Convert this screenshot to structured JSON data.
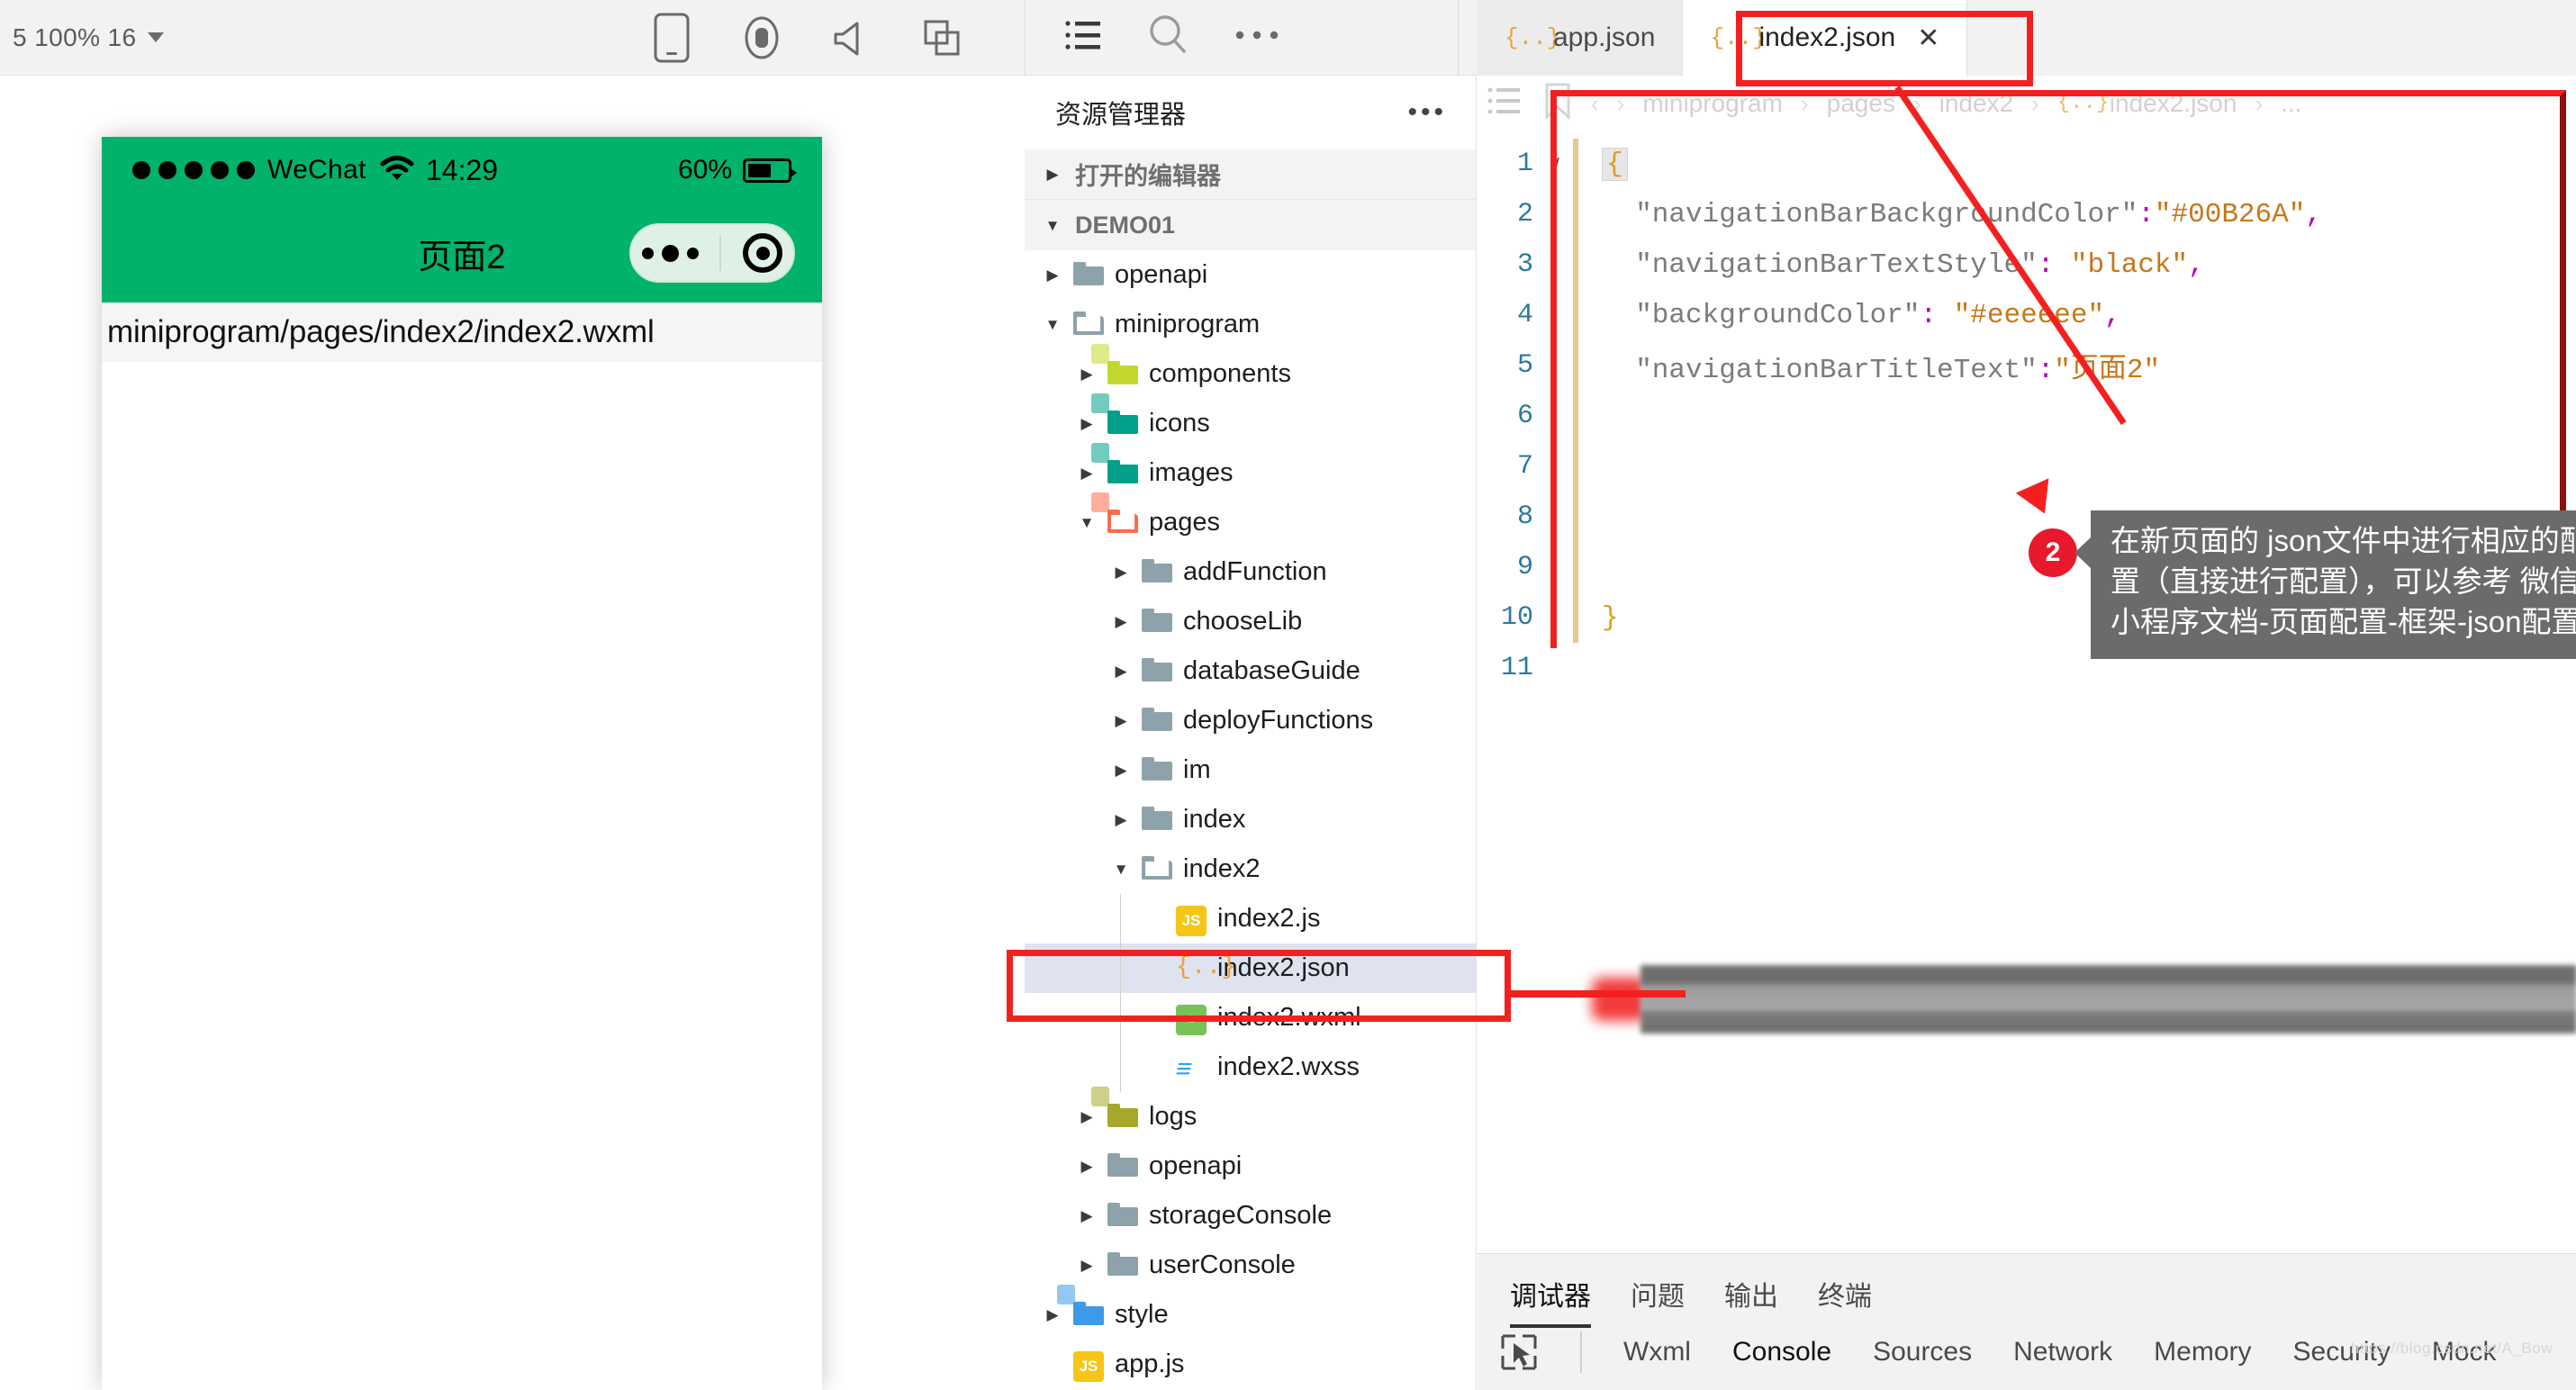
{
  "toolbar": {
    "zoom_label": "5 100% 16",
    "icons": [
      {
        "name": "device-phone-icon"
      },
      {
        "name": "record-icon"
      },
      {
        "name": "volume-icon"
      },
      {
        "name": "copy-window-icon"
      }
    ],
    "mid_icons": [
      {
        "name": "list-menu-icon"
      },
      {
        "name": "search-icon"
      },
      {
        "name": "more-ellipsis-icon"
      }
    ],
    "right_icon": {
      "name": "collapse-panel-icon"
    }
  },
  "simulator": {
    "statusbar": {
      "carrier": "WeChat",
      "time": "14:29",
      "battery_percent": "60%"
    },
    "navbar": {
      "title": "页面2",
      "background_color": "#00B26A"
    },
    "path_label": "miniprogram/pages/index2/index2.wxml"
  },
  "explorer": {
    "title": "资源管理器",
    "more_label": "•••",
    "sections": [
      {
        "label": "打开的编辑器",
        "expanded": false
      },
      {
        "label": "DEMO01",
        "expanded": true
      }
    ],
    "tree": [
      {
        "label": "openapi",
        "depth": 1,
        "type": "folder",
        "state": "right",
        "color": "#8da2ab"
      },
      {
        "label": "miniprogram",
        "depth": 1,
        "type": "folder-open",
        "state": "down",
        "color": "#8da2ab"
      },
      {
        "label": "components",
        "depth": 2,
        "type": "folder",
        "state": "right",
        "color": "#c4d72e",
        "badge": "<>"
      },
      {
        "label": "icons",
        "depth": 2,
        "type": "folder",
        "state": "right",
        "color": "#00a08a",
        "badge": "img"
      },
      {
        "label": "images",
        "depth": 2,
        "type": "folder",
        "state": "right",
        "color": "#00a08a",
        "badge": "img"
      },
      {
        "label": "pages",
        "depth": 2,
        "type": "folder-open",
        "state": "down",
        "color": "#ff6b4a",
        "badge": "<>"
      },
      {
        "label": "addFunction",
        "depth": 3,
        "type": "folder",
        "state": "right",
        "color": "#8da2ab"
      },
      {
        "label": "chooseLib",
        "depth": 3,
        "type": "folder",
        "state": "right",
        "color": "#8da2ab"
      },
      {
        "label": "databaseGuide",
        "depth": 3,
        "type": "folder",
        "state": "right",
        "color": "#8da2ab"
      },
      {
        "label": "deployFunctions",
        "depth": 3,
        "type": "folder",
        "state": "right",
        "color": "#8da2ab"
      },
      {
        "label": "im",
        "depth": 3,
        "type": "folder",
        "state": "right",
        "color": "#8da2ab"
      },
      {
        "label": "index",
        "depth": 3,
        "type": "folder",
        "state": "right",
        "color": "#8da2ab"
      },
      {
        "label": "index2",
        "depth": 3,
        "type": "folder-open",
        "state": "down",
        "color": "#8da2ab"
      },
      {
        "label": "index2.js",
        "depth": 4,
        "type": "js"
      },
      {
        "label": "index2.json",
        "depth": 4,
        "type": "json",
        "selected": true
      },
      {
        "label": "index2.wxml",
        "depth": 4,
        "type": "wxml"
      },
      {
        "label": "index2.wxss",
        "depth": 4,
        "type": "wxss"
      },
      {
        "label": "logs",
        "depth": 2,
        "type": "folder",
        "state": "right",
        "color": "#a5a82a",
        "badge": "log"
      },
      {
        "label": "openapi",
        "depth": 2,
        "type": "folder",
        "state": "right",
        "color": "#8da2ab"
      },
      {
        "label": "storageConsole",
        "depth": 2,
        "type": "folder",
        "state": "right",
        "color": "#8da2ab"
      },
      {
        "label": "userConsole",
        "depth": 2,
        "type": "folder",
        "state": "right",
        "color": "#8da2ab"
      },
      {
        "label": "style",
        "depth": 1,
        "type": "folder",
        "state": "right",
        "color": "#3d9ae8",
        "badge": "css"
      },
      {
        "label": "app.js",
        "depth": 1,
        "type": "js"
      }
    ]
  },
  "editor": {
    "tabs": [
      {
        "label": "app.json",
        "icon": "json-icon",
        "active": false,
        "closable": false
      },
      {
        "label": "index2.json",
        "icon": "json-icon",
        "active": true,
        "closable": true,
        "close_label": "✕"
      }
    ],
    "breadcrumb": [
      "miniprogram",
      "pages",
      "index2",
      "index2.json",
      "..."
    ],
    "breadcrumb_sep": "›",
    "breadcrumb_icons": [
      "list-outline-icon",
      "bookmark-icon",
      "back-arrow-icon",
      "forward-arrow-icon"
    ],
    "code": [
      {
        "num": "1",
        "fold": "∨",
        "segments": [
          {
            "t": "{",
            "c": "brace-hl k-brace"
          }
        ]
      },
      {
        "num": "2",
        "fold": "",
        "segments": [
          {
            "t": "  \"navigationBarBackgroundColor\"",
            "c": "k-str"
          },
          {
            "t": ":",
            "c": "k-pun"
          },
          {
            "t": "\"#00B26A\"",
            "c": "k-val"
          },
          {
            "t": ",",
            "c": "k-pun"
          }
        ]
      },
      {
        "num": "3",
        "fold": "",
        "segments": [
          {
            "t": "  \"navigationBarTextStyle\"",
            "c": "k-str"
          },
          {
            "t": ": ",
            "c": "k-pun"
          },
          {
            "t": "\"black\"",
            "c": "k-val"
          },
          {
            "t": ",",
            "c": "k-pun"
          }
        ]
      },
      {
        "num": "4",
        "fold": "",
        "segments": [
          {
            "t": "  \"backgroundColor\"",
            "c": "k-str"
          },
          {
            "t": ": ",
            "c": "k-pun"
          },
          {
            "t": "\"#eeeeee\"",
            "c": "k-val"
          },
          {
            "t": ",",
            "c": "k-pun"
          }
        ]
      },
      {
        "num": "5",
        "fold": "",
        "segments": [
          {
            "t": "  \"navigationBarTitleText\"",
            "c": "k-str"
          },
          {
            "t": ":",
            "c": "k-pun"
          },
          {
            "t": "\"页面2\"",
            "c": "k-val"
          }
        ]
      },
      {
        "num": "6",
        "fold": "",
        "segments": []
      },
      {
        "num": "7",
        "fold": "",
        "segments": []
      },
      {
        "num": "8",
        "fold": "",
        "segments": []
      },
      {
        "num": "9",
        "fold": "",
        "segments": []
      },
      {
        "num": "10",
        "fold": "",
        "segments": [
          {
            "t": "}",
            "c": "k-brace"
          }
        ]
      },
      {
        "num": "11",
        "fold": "",
        "segments": []
      }
    ]
  },
  "annotation": {
    "badge": "2",
    "text": "在新页面的 json文件中进行相应的配置（直接进行配置），可以参考 微信小程序文档-页面配置-框架-json配置"
  },
  "bottom_panel": {
    "tabs": [
      {
        "label": "调试器",
        "active": true
      },
      {
        "label": "问题",
        "active": false
      },
      {
        "label": "输出",
        "active": false
      },
      {
        "label": "终端",
        "active": false
      }
    ],
    "subtabs": [
      {
        "label": "Wxml",
        "active": false
      },
      {
        "label": "Console",
        "active": true
      },
      {
        "label": "Sources",
        "active": false
      },
      {
        "label": "Network",
        "active": false
      },
      {
        "label": "Memory",
        "active": false
      },
      {
        "label": "Security",
        "active": false
      },
      {
        "label": "Mock",
        "active": false
      }
    ],
    "inspect_icon": "inspect-element-icon",
    "watermark": "https://blog.csdn.net/A_Bow"
  },
  "colors": {
    "wechat_green": "#00B26A",
    "annotation_red": "#f42020",
    "selection_blue": "#dfe2ef"
  }
}
